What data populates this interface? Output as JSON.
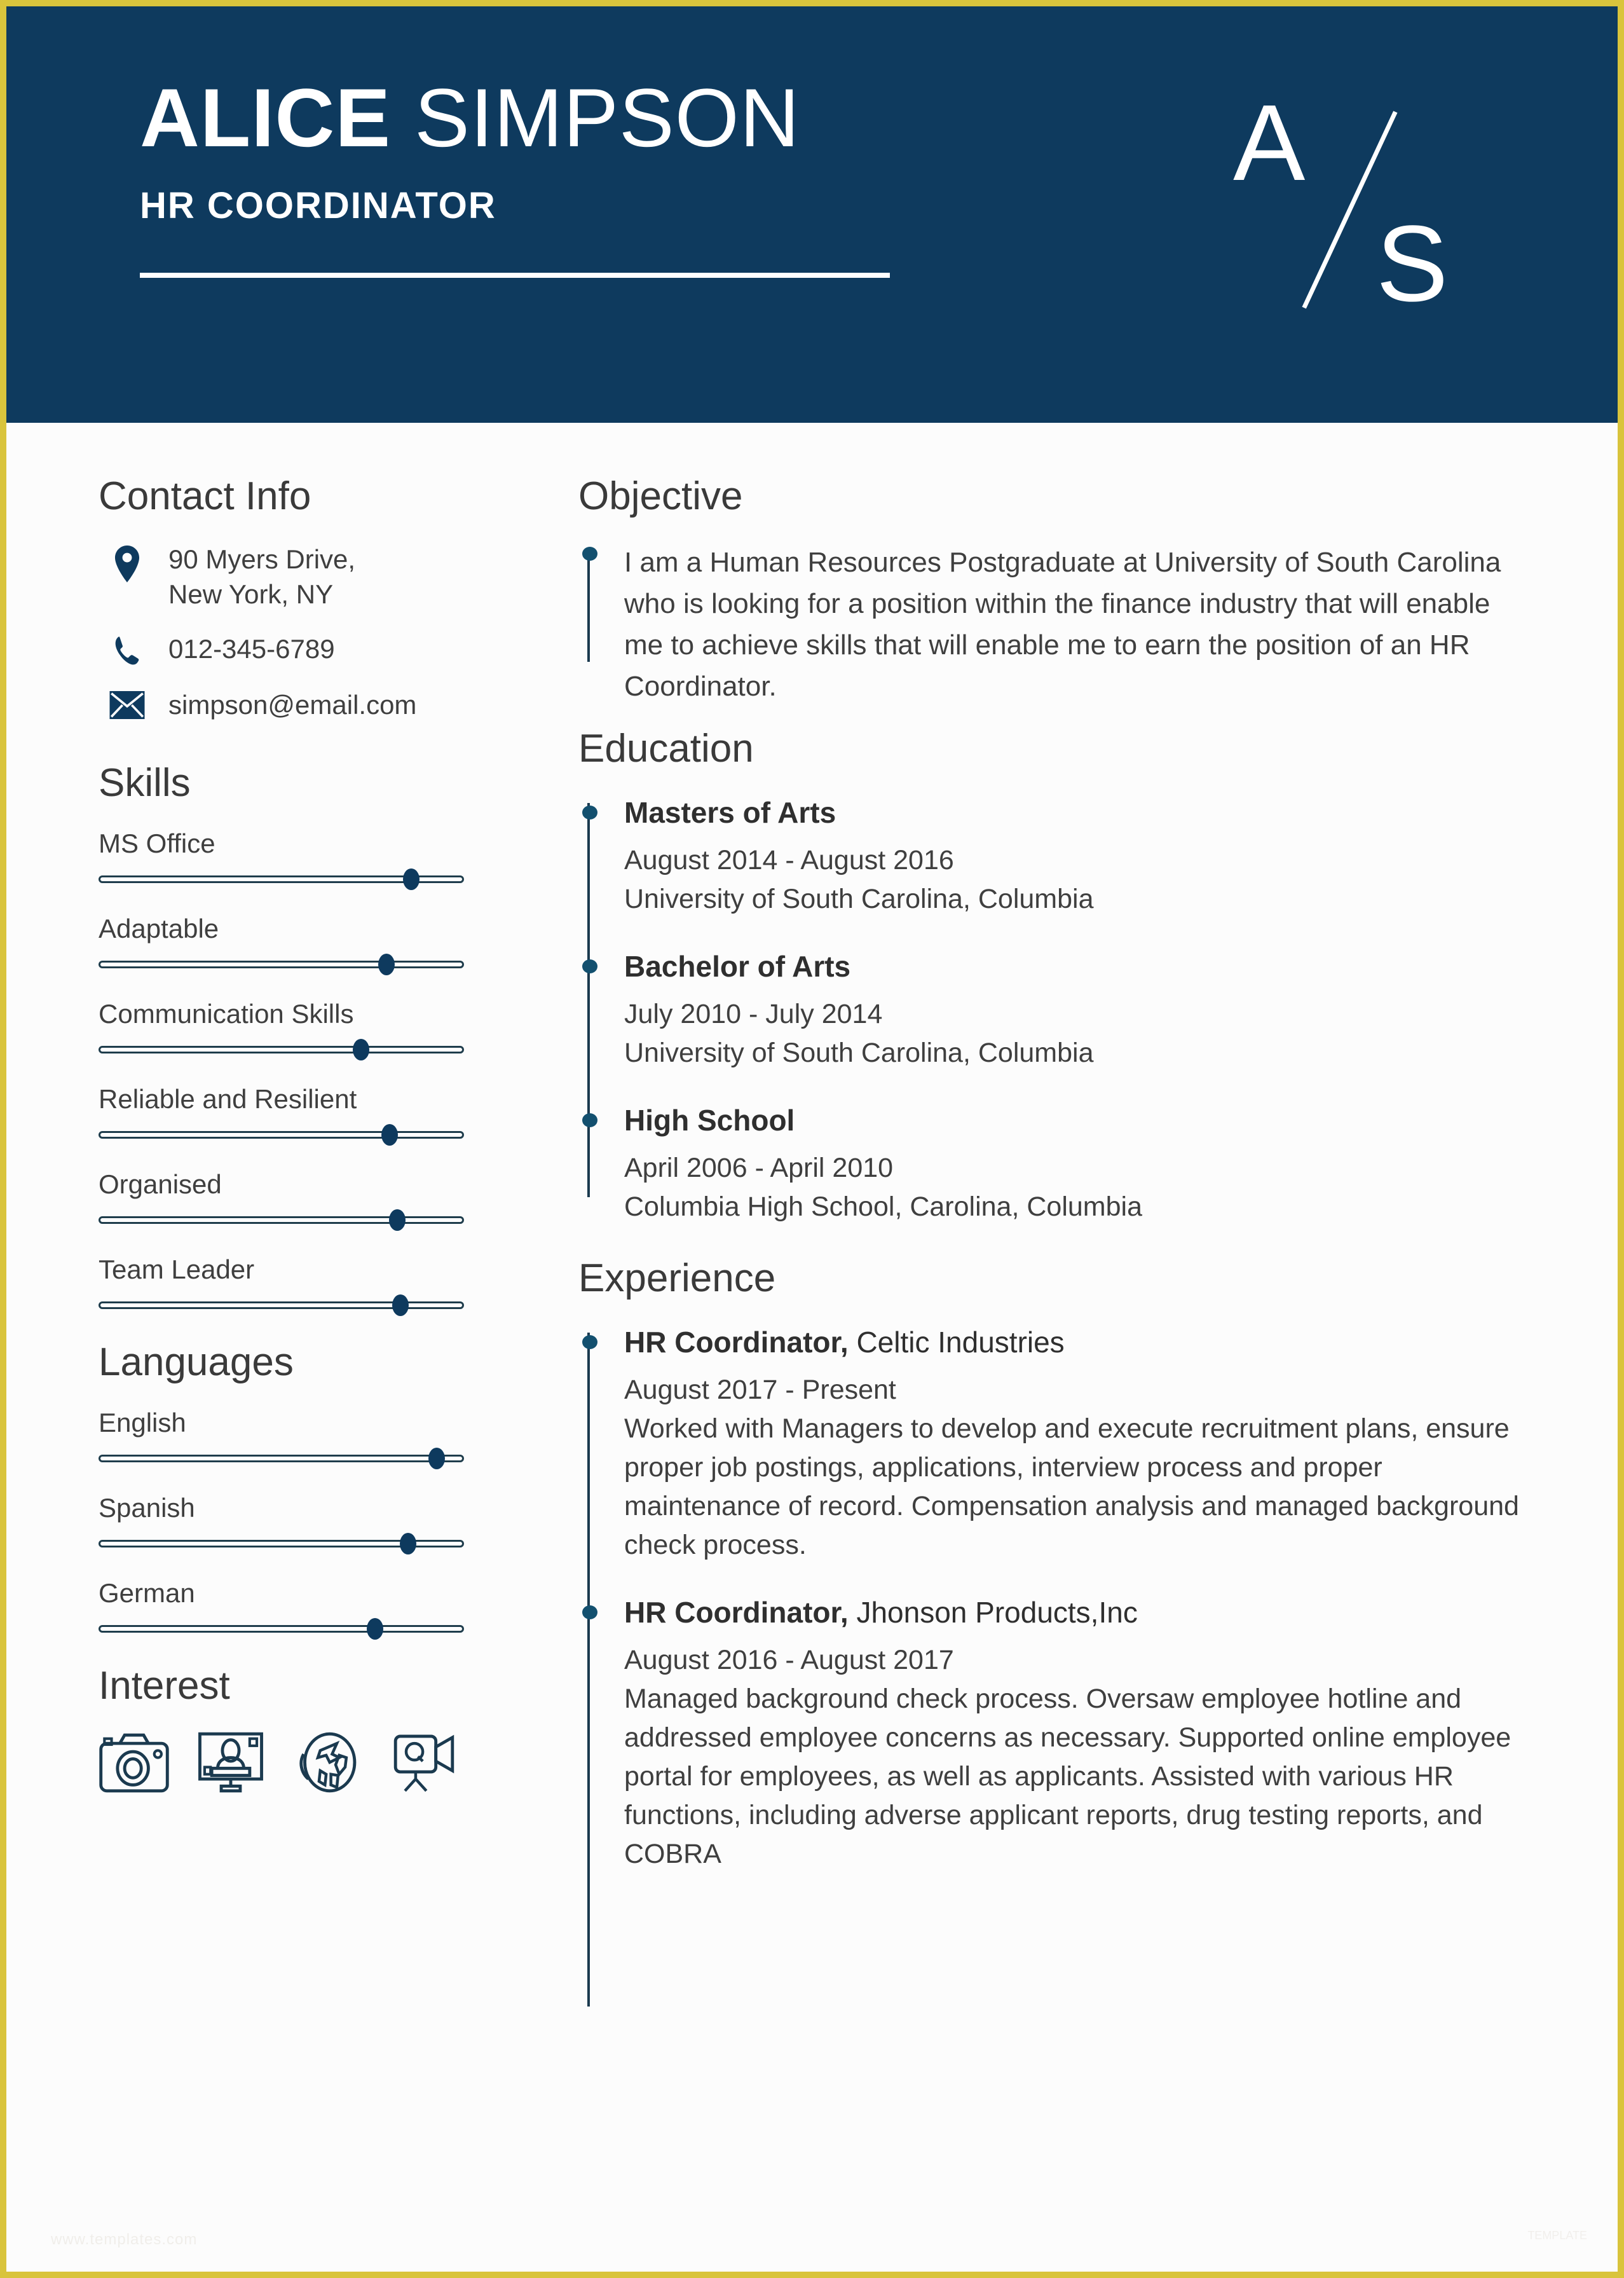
{
  "theme": {
    "navy": "#0e3a5e",
    "gold_border": "#d9c43c",
    "page_bg": "#fcfcfc",
    "text": "#3f3f3f",
    "heading": "#3a3a3a"
  },
  "header": {
    "first_name": "ALICE",
    "last_name": " SIMPSON",
    "job_title": "HR COORDINATOR",
    "monogram_initial_1": "A",
    "monogram_initial_2": "S"
  },
  "contact": {
    "heading": "Contact Info",
    "items": [
      {
        "icon": "location-pin-icon",
        "line1": "90 Myers Drive,",
        "line2": "New York, NY"
      },
      {
        "icon": "phone-icon",
        "line1": "012-345-6789",
        "line2": ""
      },
      {
        "icon": "envelope-icon",
        "line1": "simpson@email.com",
        "line2": ""
      }
    ]
  },
  "skills": {
    "heading": "Skills",
    "items": [
      {
        "label": "MS Office",
        "value": 86
      },
      {
        "label": "Adaptable",
        "value": 79
      },
      {
        "label": "Communication Skills",
        "value": 72
      },
      {
        "label": "Reliable and Resilient",
        "value": 80
      },
      {
        "label": "Organised",
        "value": 82
      },
      {
        "label": "Team Leader",
        "value": 83
      }
    ]
  },
  "languages": {
    "heading": "Languages",
    "items": [
      {
        "label": "English",
        "value": 93
      },
      {
        "label": "Spanish",
        "value": 85
      },
      {
        "label": "German",
        "value": 76
      }
    ]
  },
  "interest": {
    "heading": "Interest",
    "icons": [
      "camera-icon",
      "monitor-portrait-icon",
      "globe-airplane-icon",
      "video-camera-icon"
    ]
  },
  "objective": {
    "heading": "Objective",
    "text": "I am a Human Resources Postgraduate at University of South Carolina who is looking for a position within the finance industry that will enable me to achieve skills that will enable me to earn the position of an HR Coordinator."
  },
  "education": {
    "heading": "Education",
    "entries": [
      {
        "degree": "Masters of Arts",
        "dates": "August 2014 - August 2016",
        "institution": "University of South Carolina, Columbia"
      },
      {
        "degree": "Bachelor of Arts",
        "dates": "July 2010 - July 2014",
        "institution": "University of South Carolina, Columbia"
      },
      {
        "degree": "High School",
        "dates": "April 2006 - April 2010",
        "institution": "Columbia High School, Carolina, Columbia"
      }
    ]
  },
  "experience": {
    "heading": "Experience",
    "entries": [
      {
        "role": "HR Coordinator,",
        "company": " Celtic Industries",
        "dates": "August 2017 - Present",
        "description": "Worked with Managers to develop and execute recruitment plans, ensure proper job postings, applications, interview process and proper maintenance of record. Compensation analysis and managed background check process."
      },
      {
        "role": "HR Coordinator,",
        "company": " Jhonson Products,Inc",
        "dates": "August 2016 - August 2017",
        "description": "Managed background check process. Oversaw employee hotline and addressed employee concerns as necessary. Supported online employee portal for employees, as well as applicants. Assisted with various HR functions, including adverse applicant reports, drug testing reports, and COBRA"
      }
    ]
  },
  "watermark": {
    "url": "www.templates.com",
    "badge": "TEMPLATE"
  }
}
